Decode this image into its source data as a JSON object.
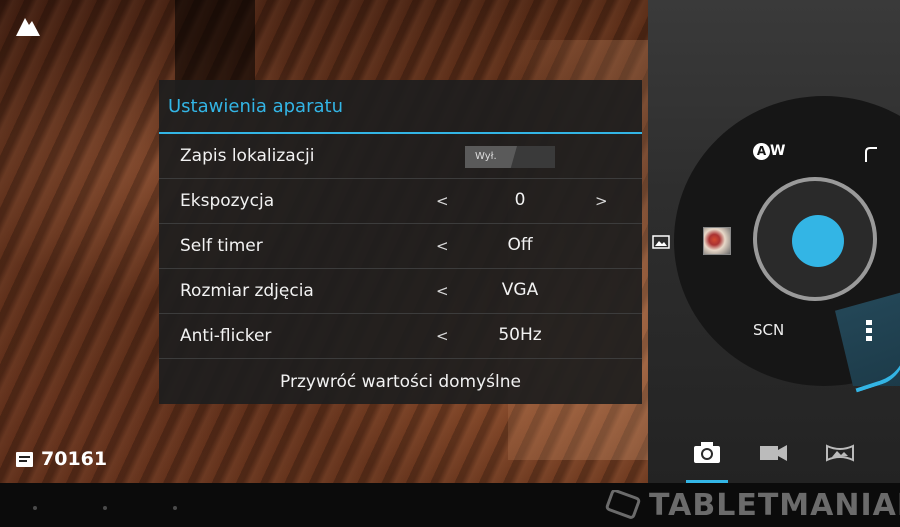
{
  "settings_panel": {
    "title": "Ustawienia aparatu",
    "rows": [
      {
        "label": "Zapis lokalizacji",
        "value": "Wył."
      },
      {
        "label": "Ekspozycja",
        "value": "0",
        "left_arrow": "<",
        "right_arrow": ">"
      },
      {
        "label": "Self timer",
        "value": "Off",
        "left_arrow": "<"
      },
      {
        "label": "Rozmiar zdjęcia",
        "value": "VGA",
        "left_arrow": "<"
      },
      {
        "label": "Anti-flicker",
        "value": "50Hz",
        "left_arrow": "<"
      }
    ],
    "reset_label": "Przywróć wartości domyślne"
  },
  "preview": {
    "remaining_shots": "70161",
    "top_left_icon": "mountain-icon",
    "storage_icon": "sd-card-icon"
  },
  "controls": {
    "white_balance_label_a": "A",
    "white_balance_label_w": "W",
    "scene_label": "SCN",
    "flash_icon": "flash-icon",
    "gallery_icon": "gallery-icon",
    "menu_icon": "more-vertical-icon",
    "accent_color": "#33b5e5"
  },
  "mode_tabs": [
    {
      "name": "camera",
      "icon": "camera-icon",
      "selected": true
    },
    {
      "name": "video",
      "icon": "video-icon",
      "selected": false
    },
    {
      "name": "panorama",
      "icon": "panorama-icon",
      "selected": false
    }
  ],
  "watermark": {
    "text": "TABLETMANIAK"
  }
}
